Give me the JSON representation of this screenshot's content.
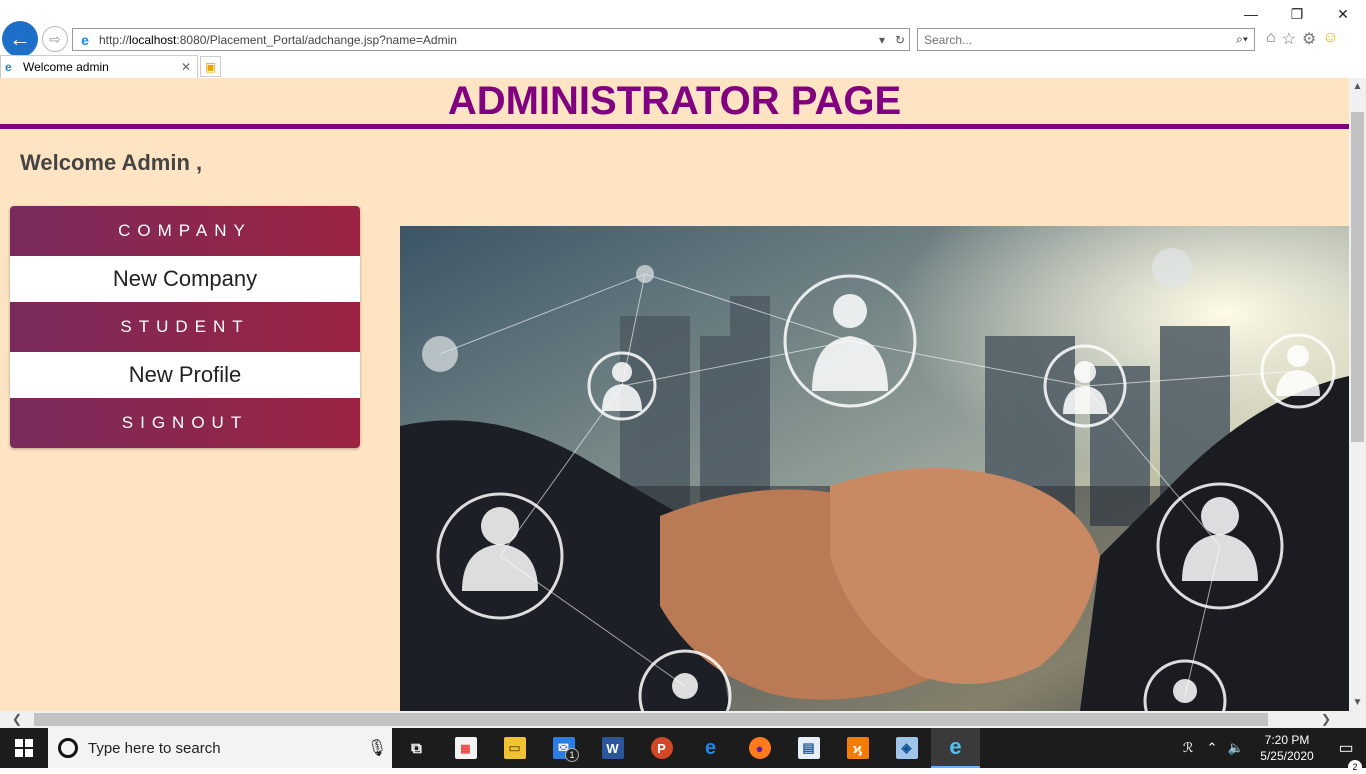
{
  "browser": {
    "url_prefix": "http://",
    "url_host": "localhost",
    "url_rest": ":8080/Placement_Portal/adchange.jsp?name=Admin",
    "search_placeholder": "Search...",
    "tab_title": "Welcome admin",
    "window_controls": {
      "minimize": "—",
      "restore": "❐",
      "close": "✕"
    }
  },
  "page": {
    "title": "ADMINISTRATOR PAGE",
    "welcome": "Welcome Admin ,",
    "menu": [
      {
        "label": "COMPANY",
        "kind": "header"
      },
      {
        "label": "New Company",
        "kind": "link"
      },
      {
        "label": "STUDENT",
        "kind": "header"
      },
      {
        "label": "New Profile",
        "kind": "link"
      },
      {
        "label": "SIGNOUT",
        "kind": "header"
      }
    ],
    "hero_image": "business-handshake-network-photo",
    "colors": {
      "title": "#800080",
      "background": "#ffe4c4",
      "menu_gradient_start": "#7a2a5c",
      "menu_gradient_end": "#9c2342"
    }
  },
  "taskbar": {
    "search_placeholder": "Type here to search",
    "apps": [
      "task-view-icon",
      "store-icon",
      "file-explorer-icon",
      "mail-icon",
      "word-icon",
      "powerpoint-icon",
      "edge-icon",
      "firefox-icon",
      "app-icon",
      "xampp-icon",
      "virtualbox-icon",
      "internet-explorer-icon"
    ],
    "mail_badge": "1",
    "time": "7:20 PM",
    "date": "5/25/2020",
    "notification_badge": "2"
  }
}
